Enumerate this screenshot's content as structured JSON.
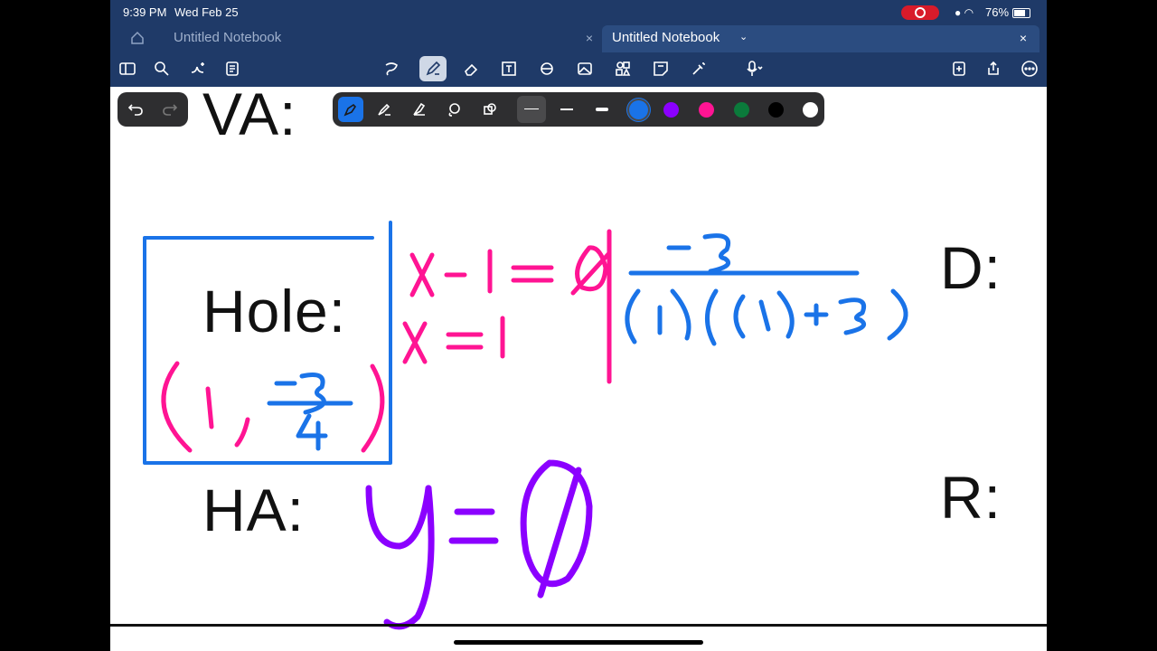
{
  "status_bar": {
    "time": "9:39 PM",
    "date": "Wed Feb 25",
    "battery": "76%"
  },
  "tabs": [
    {
      "label": "Untitled Notebook"
    },
    {
      "label": "Untitled Notebook"
    }
  ],
  "toolbar": {
    "tools": [
      "lasso-icon",
      "pen-icon",
      "eraser-icon",
      "text-box-icon",
      "shapes-icon",
      "image-icon",
      "elements-icon",
      "sticky-note-icon",
      "laser-pointer-icon",
      "microphone-icon"
    ],
    "right": [
      "add-page-icon",
      "share-icon",
      "more-icon"
    ]
  },
  "pen_palette": {
    "tools": [
      "fountain-pen-icon",
      "ball-pen-icon",
      "brush-pen-icon",
      "lasso-pen-icon",
      "shape-pen-icon"
    ],
    "colors": [
      "#1a73e8",
      "#8b00ff",
      "#ff1493",
      "#0b7a3b",
      "#000000",
      "#ffffff"
    ],
    "selected_color": "#1a73e8"
  },
  "notebook": {
    "va_label": "VA:",
    "hole_label": "Hole:",
    "ha_label": "HA:",
    "d_label": "D:",
    "r_label": "R:"
  }
}
